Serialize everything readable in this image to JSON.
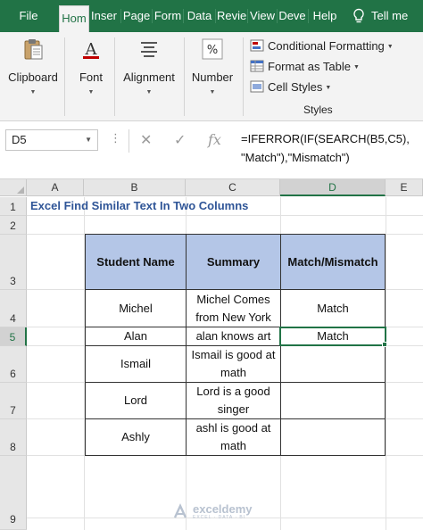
{
  "tabs": [
    {
      "label": "File"
    },
    {
      "label": "Hom"
    },
    {
      "label": "Inser"
    },
    {
      "label": "Page"
    },
    {
      "label": "Form"
    },
    {
      "label": "Data"
    },
    {
      "label": "Revie"
    },
    {
      "label": "View"
    },
    {
      "label": "Deve"
    },
    {
      "label": "Help"
    },
    {
      "label": "Tell me"
    }
  ],
  "active_tab": "Hom",
  "ribbon": {
    "clipboard": "Clipboard",
    "font": "Font",
    "alignment": "Alignment",
    "number": "Number",
    "styles": {
      "conditional_formatting": "Conditional Formatting",
      "format_as_table": "Format as Table",
      "cell_styles": "Cell Styles",
      "group_label": "Styles"
    }
  },
  "formula_bar": {
    "name_box": "D5",
    "formula": "=IFERROR(IF(SEARCH(B5,C5),\n\"Match\"),\"Mismatch\")"
  },
  "columns": [
    "A",
    "B",
    "C",
    "D",
    "E"
  ],
  "selected_column": "D",
  "rows": [
    "1",
    "2",
    "3",
    "4",
    "5",
    "6",
    "7",
    "8",
    "9"
  ],
  "selected_row": "5",
  "sheet": {
    "title": "Excel Find Similar Text In Two Columns",
    "headers": [
      "Student Name",
      "Summary",
      "Match/Mismatch"
    ],
    "data": [
      [
        "Michel",
        "Michel Comes from New York",
        "Match"
      ],
      [
        "Alan",
        "alan knows art",
        "Match"
      ],
      [
        "Ismail",
        "Ismail is good at math",
        ""
      ],
      [
        "Lord",
        "Lord is a good singer",
        ""
      ],
      [
        "Ashly",
        "ashl is good at math",
        ""
      ]
    ]
  },
  "watermark": {
    "name": "exceldemy",
    "tagline": "EXCEL · DATA · BI"
  },
  "colors": {
    "excel_green": "#217346",
    "header_fill": "#b4c6e7",
    "title_blue": "#2f5597"
  }
}
